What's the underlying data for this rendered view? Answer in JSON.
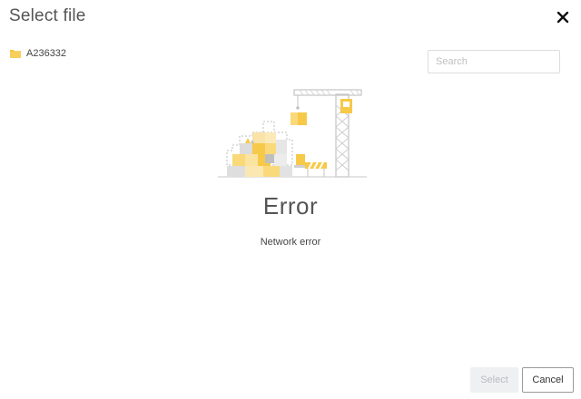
{
  "dialog": {
    "title": "Select file",
    "close_icon": "close-icon"
  },
  "breadcrumb": {
    "folder_icon": "folder-icon",
    "label": "A236332"
  },
  "search": {
    "placeholder": "Search",
    "value": ""
  },
  "error": {
    "illustration": "construction-crane-illustration",
    "heading": "Error",
    "message": "Network error"
  },
  "footer": {
    "select_label": "Select",
    "cancel_label": "Cancel"
  },
  "colors": {
    "accent_yellow": "#f7c948",
    "disabled_button_bg": "#eef0f2",
    "disabled_button_text": "#b8bcc0"
  }
}
